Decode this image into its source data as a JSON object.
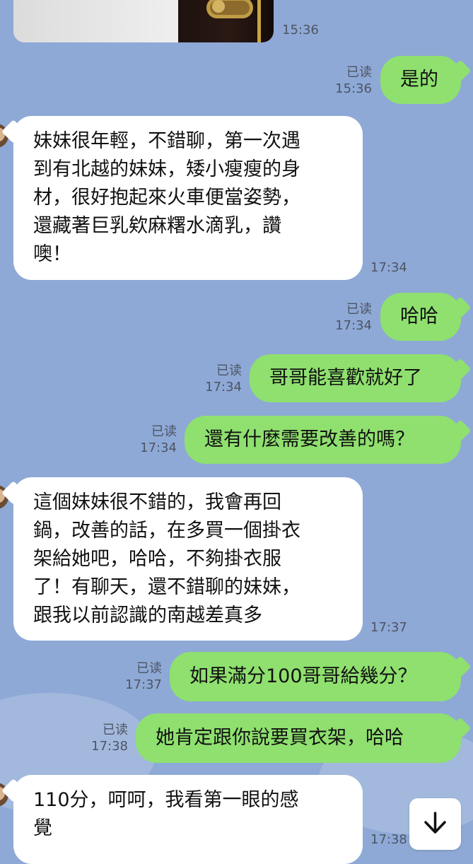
{
  "messages": [
    {
      "id": "m1",
      "direction": "in",
      "type": "image",
      "time": "15:36"
    },
    {
      "id": "m2",
      "direction": "out",
      "text": "是的",
      "read_label": "已读",
      "time": "15:36"
    },
    {
      "id": "m3",
      "direction": "in",
      "text": "妹妹很年輕，不錯聊，第一次遇\n到有北越的妹妹，矮小瘦瘦的身\n材，很好抱起來火車便當姿勢，\n還藏著巨乳欸麻糬水滴乳，讚\n噢！",
      "time": "17:34"
    },
    {
      "id": "m4",
      "direction": "out",
      "text": "哈哈",
      "read_label": "已读",
      "time": "17:34"
    },
    {
      "id": "m5",
      "direction": "out",
      "text": "哥哥能喜歡就好了",
      "read_label": "已读",
      "time": "17:34"
    },
    {
      "id": "m6",
      "direction": "out",
      "text": "還有什麼需要改善的嗎？",
      "read_label": "已读",
      "time": "17:34"
    },
    {
      "id": "m7",
      "direction": "in",
      "text": "這個妹妹很不錯的，我會再回\n鍋，改善的話，在多買一個掛衣\n架給她吧，哈哈，不夠掛衣服\n了！有聊天，還不錯聊的妹妹，\n跟我以前認識的南越差真多",
      "time": "17:37"
    },
    {
      "id": "m8",
      "direction": "out",
      "text": "如果滿分100哥哥給幾分？",
      "read_label": "已读",
      "time": "17:37"
    },
    {
      "id": "m9",
      "direction": "out",
      "text": "她肯定跟你說要買衣架，哈哈",
      "read_label": "已读",
      "time": "17:38"
    },
    {
      "id": "m10",
      "direction": "in",
      "text": "110分，呵呵，我看第一眼的感\n覺",
      "time": "17:38"
    }
  ],
  "icons": {
    "scroll_down": "arrow-down-icon",
    "avatar": "avatar"
  },
  "colors": {
    "background": "#8ea9d6",
    "incoming_bubble": "#ffffff",
    "outgoing_bubble": "#8fe06f",
    "meta_text": "#4d5563"
  }
}
